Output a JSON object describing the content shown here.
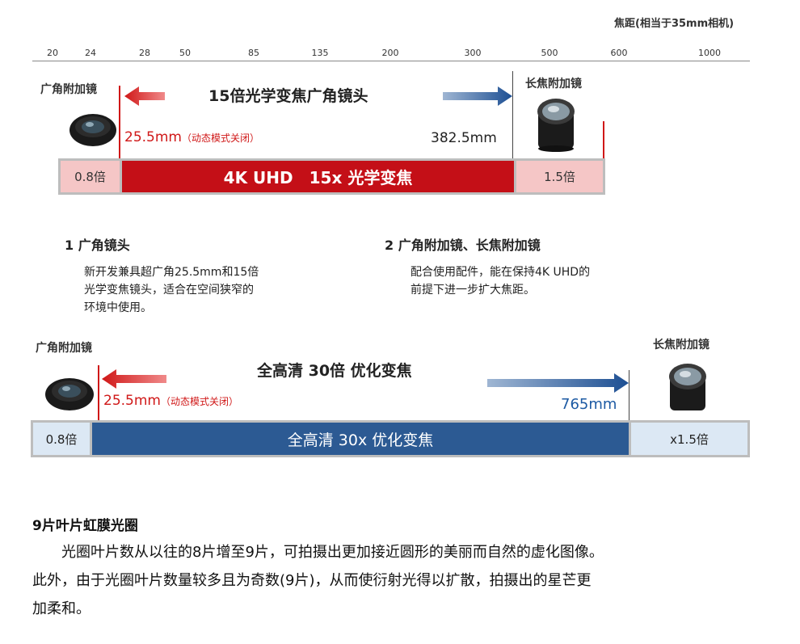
{
  "scale": {
    "title": "焦距(相当于35mm相机)",
    "ticks": [
      "20",
      "24",
      "28",
      "50",
      "85",
      "135",
      "200",
      "300",
      "500",
      "600",
      "1000"
    ]
  },
  "diagram1": {
    "left_label": "广角附加镜",
    "right_label": "长焦附加镜",
    "title": "15倍光学变焦广角镜头",
    "min_mm": "25.5mm",
    "min_note": "（动态模式关闭）",
    "max_mm": "382.5mm",
    "bar_left": "0.8倍",
    "bar_main": "4K UHD　15x 光学变焦",
    "bar_right": "1.5倍"
  },
  "features": [
    {
      "heading": "1  广角镜头",
      "lines": [
        "新开发兼具超广角25.5mm和15倍",
        "光学变焦镜头，适合在空间狭窄的",
        "环境中使用。"
      ]
    },
    {
      "heading": "2  广角附加镜、长焦附加镜",
      "lines": [
        "配合使用配件，能在保持4K UHD的",
        "前提下进一步扩大焦距。"
      ]
    }
  ],
  "diagram2": {
    "left_label": "广角附加镜",
    "right_label": "长焦附加镜",
    "title": "全高清 30倍 优化变焦",
    "min_mm": "25.5mm",
    "min_note": "（动态模式关闭）",
    "max_mm": "765mm",
    "bar_left": "0.8倍",
    "bar_main": "全高清 30x 优化变焦",
    "bar_right": "x1.5倍"
  },
  "article": {
    "heading": "9片叶片虹膜光圈",
    "lines": [
      "　　光圈叶片数从以往的8片增至9片，可拍摄出更加接近圆形的美丽而自然的虚化图像。",
      "此外，由于光圈叶片数量较多且为奇数(9片)，从而使衍射光得以扩散，拍摄出的星芒更",
      "加柔和。"
    ]
  },
  "colors": {
    "red": "#d01818",
    "blue": "#1d5aa3",
    "pink": "#f5c6c6",
    "lightblue": "#dce8f4"
  }
}
